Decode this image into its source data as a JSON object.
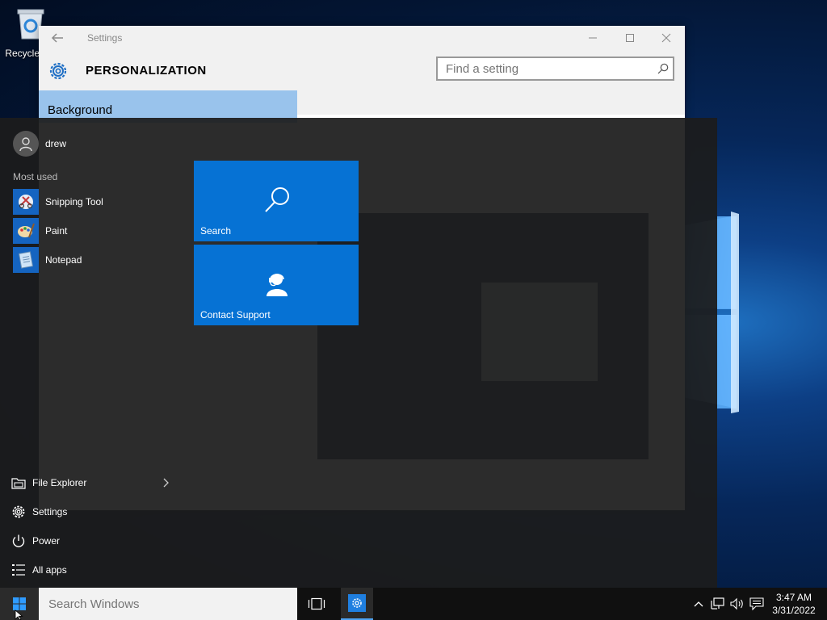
{
  "desktop": {
    "recycle_bin_label": "Recycle Bin",
    "accent_color": "#0672d4"
  },
  "settings_window": {
    "title": "Settings",
    "page_title": "PERSONALIZATION",
    "search_placeholder": "Find a setting",
    "selected_nav_item": "Background",
    "icons": [
      "back-arrow-icon",
      "gear-icon",
      "minimize-icon",
      "maximize-icon",
      "close-icon",
      "search-icon"
    ]
  },
  "start_menu": {
    "user_name": "drew",
    "most_used_heading": "Most used",
    "most_used": [
      {
        "label": "Snipping Tool",
        "icon": "snipping-tool-icon"
      },
      {
        "label": "Paint",
        "icon": "paint-icon"
      },
      {
        "label": "Notepad",
        "icon": "notepad-icon"
      }
    ],
    "tiles": [
      {
        "label": "Search",
        "icon": "search-icon"
      },
      {
        "label": "Contact Support",
        "icon": "contact-support-icon"
      }
    ],
    "system_items": [
      {
        "label": "File Explorer",
        "icon": "file-explorer-icon"
      },
      {
        "label": "Settings",
        "icon": "gear-icon"
      },
      {
        "label": "Power",
        "icon": "power-icon"
      },
      {
        "label": "All apps",
        "icon": "all-apps-icon"
      }
    ]
  },
  "taskbar": {
    "search_placeholder": "Search Windows",
    "time": "3:47 AM",
    "date": "3/31/2022"
  }
}
